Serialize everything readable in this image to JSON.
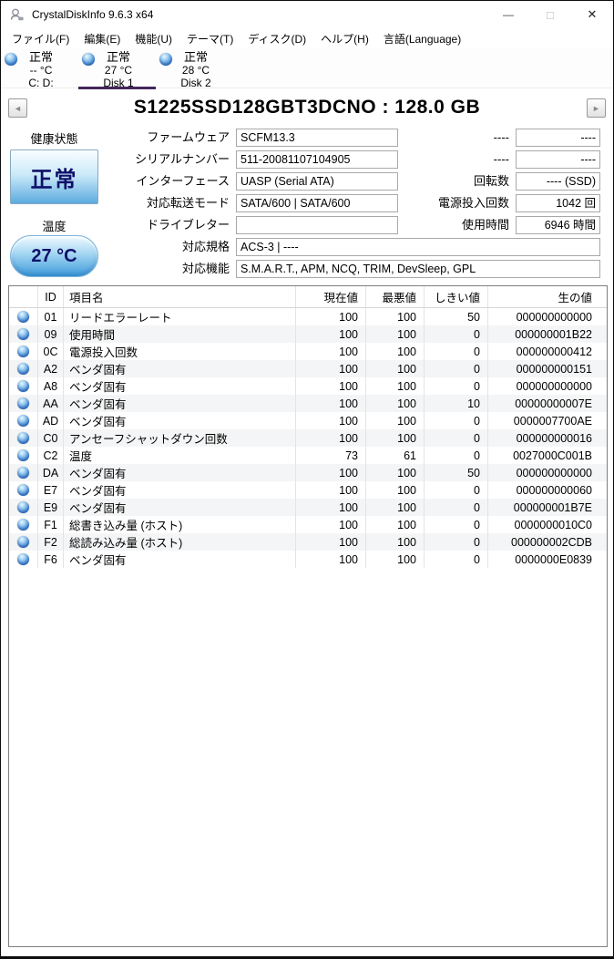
{
  "window": {
    "title": "CrystalDiskInfo 9.6.3 x64",
    "minimize_glyph": "—",
    "maximize_glyph": "□",
    "close_glyph": "✕"
  },
  "menu": {
    "items": [
      {
        "key": "file",
        "label": "ファイル(F)"
      },
      {
        "key": "edit",
        "label": "編集(E)"
      },
      {
        "key": "function",
        "label": "機能(U)"
      },
      {
        "key": "theme",
        "label": "テーマ(T)"
      },
      {
        "key": "disk",
        "label": "ディスク(D)"
      },
      {
        "key": "help",
        "label": "ヘルプ(H)"
      },
      {
        "key": "language",
        "label": "言語(Language)"
      }
    ]
  },
  "disk_tabs": [
    {
      "status": "正常",
      "temperature": "-- °C",
      "name": "C: D:",
      "selected": false
    },
    {
      "status": "正常",
      "temperature": "27 °C",
      "name": "Disk 1",
      "selected": true
    },
    {
      "status": "正常",
      "temperature": "28 °C",
      "name": "Disk 2",
      "selected": false
    }
  ],
  "drive_header": {
    "prev_glyph": "◄",
    "next_glyph": "►",
    "title": "S1225SSD128GBT3DCNO : 128.0 GB"
  },
  "health": {
    "label": "健康状態",
    "status": "正常"
  },
  "temperature": {
    "label": "温度",
    "value": "27 °C"
  },
  "info_fields": {
    "left": [
      {
        "label": "ファームウェア",
        "value": "SCFM13.3"
      },
      {
        "label": "シリアルナンバー",
        "value": "511-20081107104905"
      },
      {
        "label": "インターフェース",
        "value": "UASP (Serial ATA)"
      },
      {
        "label": "対応転送モード",
        "value": "SATA/600 | SATA/600"
      },
      {
        "label": "ドライブレター",
        "value": ""
      }
    ],
    "wide": [
      {
        "label": "対応規格",
        "value": "ACS-3 | ----"
      },
      {
        "label": "対応機能",
        "value": "S.M.A.R.T., APM, NCQ, TRIM, DevSleep, GPL"
      }
    ],
    "right": [
      {
        "label": "----",
        "value": "----"
      },
      {
        "label": "----",
        "value": "----"
      },
      {
        "label": "回転数",
        "value": "---- (SSD)"
      },
      {
        "label": "電源投入回数",
        "value": "1042 回"
      },
      {
        "label": "使用時間",
        "value": "6946 時間"
      }
    ]
  },
  "smart_table": {
    "headers": {
      "id": "ID",
      "name": "項目名",
      "current": "現在値",
      "worst": "最悪値",
      "threshold": "しきい値",
      "raw": "生の値"
    },
    "rows": [
      {
        "id": "01",
        "name": "リードエラーレート",
        "current": "100",
        "worst": "100",
        "threshold": "50",
        "raw": "000000000000"
      },
      {
        "id": "09",
        "name": "使用時間",
        "current": "100",
        "worst": "100",
        "threshold": "0",
        "raw": "000000001B22"
      },
      {
        "id": "0C",
        "name": "電源投入回数",
        "current": "100",
        "worst": "100",
        "threshold": "0",
        "raw": "000000000412"
      },
      {
        "id": "A2",
        "name": "ベンダ固有",
        "current": "100",
        "worst": "100",
        "threshold": "0",
        "raw": "000000000151"
      },
      {
        "id": "A8",
        "name": "ベンダ固有",
        "current": "100",
        "worst": "100",
        "threshold": "0",
        "raw": "000000000000"
      },
      {
        "id": "AA",
        "name": "ベンダ固有",
        "current": "100",
        "worst": "100",
        "threshold": "10",
        "raw": "00000000007E"
      },
      {
        "id": "AD",
        "name": "ベンダ固有",
        "current": "100",
        "worst": "100",
        "threshold": "0",
        "raw": "0000007700AE"
      },
      {
        "id": "C0",
        "name": "アンセーフシャットダウン回数",
        "current": "100",
        "worst": "100",
        "threshold": "0",
        "raw": "000000000016"
      },
      {
        "id": "C2",
        "name": "温度",
        "current": "73",
        "worst": "61",
        "threshold": "0",
        "raw": "0027000C001B"
      },
      {
        "id": "DA",
        "name": "ベンダ固有",
        "current": "100",
        "worst": "100",
        "threshold": "50",
        "raw": "000000000000"
      },
      {
        "id": "E7",
        "name": "ベンダ固有",
        "current": "100",
        "worst": "100",
        "threshold": "0",
        "raw": "000000000060"
      },
      {
        "id": "E9",
        "name": "ベンダ固有",
        "current": "100",
        "worst": "100",
        "threshold": "0",
        "raw": "000000001B7E"
      },
      {
        "id": "F1",
        "name": "総書き込み量 (ホスト)",
        "current": "100",
        "worst": "100",
        "threshold": "0",
        "raw": "0000000010C0"
      },
      {
        "id": "F2",
        "name": "総読み込み量 (ホスト)",
        "current": "100",
        "worst": "100",
        "threshold": "0",
        "raw": "000000002CDB"
      },
      {
        "id": "F6",
        "name": "ベンダ固有",
        "current": "100",
        "worst": "100",
        "threshold": "0",
        "raw": "0000000E0839"
      }
    ]
  },
  "colors": {
    "selected_tab_underline": "#45275d",
    "status_orb_blue": "#2f6fd0",
    "health_box_blue": "#5cacdf",
    "status_text_navy": "#10106a"
  }
}
